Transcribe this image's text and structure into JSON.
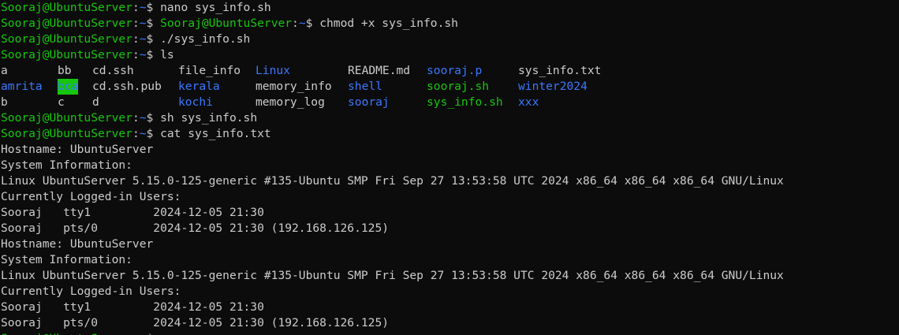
{
  "prompt": {
    "user_host": "Sooraj@UbuntuServer",
    "separator": ":",
    "path": "~",
    "symbol": "$ "
  },
  "session": [
    {
      "cmd": "nano sys_info.sh"
    },
    {
      "cmd": "chmod +x sys_info.sh",
      "leading_host": "Sooraj@UbuntuServer:~"
    },
    {
      "cmd": "./sys_info.sh"
    },
    {
      "cmd": "ls"
    }
  ],
  "ls_rows": [
    [
      {
        "name": "a",
        "type": "file"
      },
      {
        "name": "bb",
        "type": "file"
      },
      {
        "name": "cd.ssh",
        "type": "file"
      },
      {
        "name": "file_info",
        "type": "file"
      },
      {
        "name": "Linux",
        "type": "dir"
      },
      {
        "name": "README.md",
        "type": "file"
      },
      {
        "name": "sooraj.p",
        "type": "dir"
      },
      {
        "name": "sys_info.txt",
        "type": "file"
      }
    ],
    [
      {
        "name": "amrita",
        "type": "dir"
      },
      {
        "name": "bca",
        "type": "highlight"
      },
      {
        "name": "cd.ssh.pub",
        "type": "file"
      },
      {
        "name": "kerala",
        "type": "dir"
      },
      {
        "name": "memory_info",
        "type": "file"
      },
      {
        "name": "shell",
        "type": "dir"
      },
      {
        "name": "sooraj.sh",
        "type": "exec"
      },
      {
        "name": "winter2024",
        "type": "dir"
      }
    ],
    [
      {
        "name": "b",
        "type": "file"
      },
      {
        "name": "c",
        "type": "file"
      },
      {
        "name": "d",
        "type": "file"
      },
      {
        "name": "kochi",
        "type": "dir"
      },
      {
        "name": "memory_log",
        "type": "file"
      },
      {
        "name": "sooraj",
        "type": "dir"
      },
      {
        "name": "sys_info.sh",
        "type": "exec"
      },
      {
        "name": "xxx",
        "type": "dir"
      }
    ]
  ],
  "after_ls": [
    {
      "cmd": "sh sys_info.sh"
    },
    {
      "cmd": "cat sys_info.txt"
    }
  ],
  "output": [
    "Hostname: UbuntuServer",
    "System Information:",
    "Linux UbuntuServer 5.15.0-125-generic #135-Ubuntu SMP Fri Sep 27 13:53:58 UTC 2024 x86_64 x86_64 x86_64 GNU/Linux",
    "Currently Logged-in Users:",
    "Sooraj   tty1         2024-12-05 21:30",
    "Sooraj   pts/0        2024-12-05 21:30 (192.168.126.125)",
    "Hostname: UbuntuServer",
    "System Information:",
    "Linux UbuntuServer 5.15.0-125-generic #135-Ubuntu SMP Fri Sep 27 13:53:58 UTC 2024 x86_64 x86_64 x86_64 GNU/Linux",
    "Currently Logged-in Users:",
    "Sooraj   tty1         2024-12-05 21:30",
    "Sooraj   pts/0        2024-12-05 21:30 (192.168.126.125)"
  ],
  "colors": {
    "background": "#0c0c0c",
    "user_host": "#16c60c",
    "path": "#3b78ff",
    "text": "#cccccc",
    "dir": "#3b78ff",
    "exec": "#16c60c",
    "highlight_bg": "#16c60c",
    "highlight_fg": "#3b78ff"
  }
}
